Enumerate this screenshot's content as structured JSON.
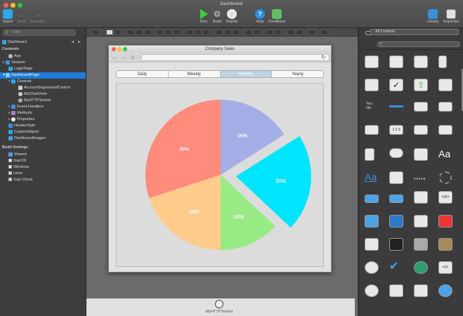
{
  "window_title": "Dashboard",
  "toolbar": {
    "insert": "Insert",
    "back": "Back",
    "forward": "Forward",
    "run": "Run",
    "build": "Build",
    "deploy": "Deploy",
    "help": "Help",
    "feedback": "Feedback",
    "library": "Library",
    "inspector": "Inspector"
  },
  "navigator": {
    "filter_placeholder": "Filter",
    "project": "Dashboard",
    "contents_header": "Contents",
    "items": [
      "App",
      "Session",
      "LoginPage",
      "DashboardPage",
      "Controls",
      "AccountSegmentedControl",
      "MyChartView",
      "MyHTTPSocket",
      "Event Handlers",
      "Methods",
      "Properties",
      "HeaderStyle",
      "CustomObject",
      "DashboardImages"
    ],
    "build_header": "Build Settings",
    "build_items": [
      "Shared",
      "macOS",
      "Windows",
      "Linux",
      "Xojo Cloud"
    ]
  },
  "library": {
    "filter": "All Controls",
    "yes": "Yes",
    "no": "No",
    "aa": "Aa",
    "num": "1 2 3"
  },
  "designer": {
    "window_title": "Company Sales",
    "tabs": [
      "Daily",
      "Weekly",
      "Monthly",
      "Yearly"
    ],
    "socket_label": "MyHTTPSocket"
  },
  "chart_data": {
    "type": "pie",
    "categories": [
      "16%",
      "21%",
      "13%",
      "20%",
      "30%"
    ],
    "values": [
      16,
      21,
      13,
      20,
      30
    ],
    "colors": [
      "#a3aee6",
      "#00e5ff",
      "#98eb84",
      "#ffcc8c",
      "#ff8b7c"
    ],
    "exploded": [
      false,
      true,
      false,
      false,
      false
    ]
  }
}
